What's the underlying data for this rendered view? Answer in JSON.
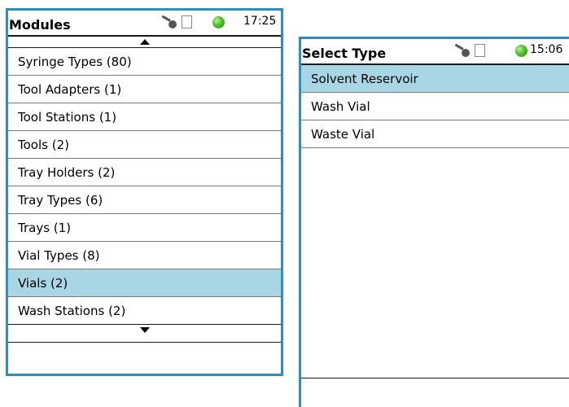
{
  "left_panel": {
    "title": "Modules",
    "time": "17:25",
    "items": [
      {
        "label": "Syringe Types (80)",
        "selected": false
      },
      {
        "label": "Tool Adapters (1)",
        "selected": false
      },
      {
        "label": "Tool Stations (1)",
        "selected": false
      },
      {
        "label": "Tools (2)",
        "selected": false
      },
      {
        "label": "Tray Holders (2)",
        "selected": false
      },
      {
        "label": "Tray Types (6)",
        "selected": false
      },
      {
        "label": "Trays (1)",
        "selected": false
      },
      {
        "label": "Vial Types (8)",
        "selected": false
      },
      {
        "label": "Vials (2)",
        "selected": true
      },
      {
        "label": "Wash Stations (2)",
        "selected": false
      }
    ]
  },
  "right_panel": {
    "title": "Select Type",
    "time": "15:06",
    "items": [
      {
        "label": "Solvent Reservoir",
        "selected": true
      },
      {
        "label": "Wash Vial",
        "selected": false
      },
      {
        "label": "Waste Vial",
        "selected": false
      }
    ]
  },
  "icons": {
    "key": "key-icon",
    "usb": "usb-icon",
    "status_led": "status-led-icon",
    "scroll_up": "scroll-up-icon",
    "scroll_down": "scroll-down-icon"
  },
  "colors": {
    "frame_border": "#2b8fbf",
    "selection": "#a9d6e5",
    "status_led": "#4cbf2a"
  }
}
